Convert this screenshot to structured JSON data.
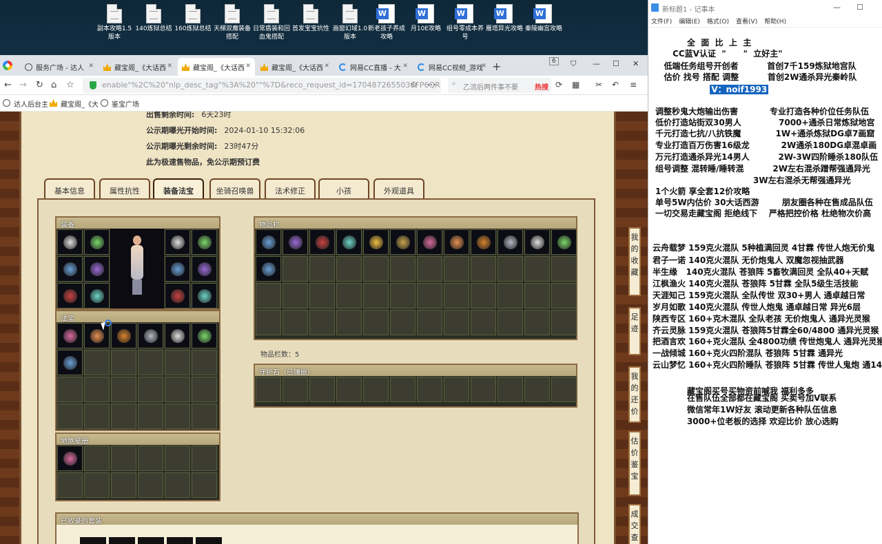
{
  "desktop": {
    "icons": [
      {
        "label": "副本攻略1.5版本",
        "type": "file"
      },
      {
        "label": "140炼狱总结",
        "type": "file"
      },
      {
        "label": "160炼狱总结",
        "type": "file"
      },
      {
        "label": "天梯双魔装备搭配",
        "type": "file"
      },
      {
        "label": "日常盾装和回血鬼搭配",
        "type": "file"
      },
      {
        "label": "首发宝宝抗性",
        "type": "file"
      },
      {
        "label": "画窗幻域1.0版本",
        "type": "file"
      },
      {
        "label": "新老孩子养成攻略",
        "type": "word"
      },
      {
        "label": "月10E攻略",
        "type": "word"
      },
      {
        "label": "组号零成本养号",
        "type": "word"
      },
      {
        "label": "雁塔异光攻略",
        "type": "word"
      },
      {
        "label": "秦陵幽宫攻略",
        "type": "word"
      }
    ]
  },
  "browser": {
    "tabs": [
      {
        "label": "服务广场 - 达人",
        "icon": "globe-icon",
        "active": false
      },
      {
        "label": "藏宝阁_《大话西",
        "icon": "crown-icon",
        "active": false
      },
      {
        "label": "藏宝阁_《大话西",
        "icon": "crown-icon",
        "active": true
      },
      {
        "label": "藏宝阁_《大话西",
        "icon": "crown-icon",
        "active": false
      },
      {
        "label": "网易CC直播 - 大",
        "icon": "cc-icon",
        "active": false
      },
      {
        "label": "网易CC视频_游戏",
        "icon": "cc-icon",
        "active": false
      }
    ],
    "tab_count": "6",
    "url": "enable\"%2C%20\"nlp_desc_tag\"%3A%20\"\"%7D&reco_request_id=1704872655036FP6QR",
    "search_placeholder": "乙流后两件事不要",
    "hot_label": "热搜",
    "bookmarks": [
      "达人后台主",
      "藏宝阁_《大",
      "鉴宝广场"
    ]
  },
  "page": {
    "info_rows": [
      {
        "label": "出售剩余时间:",
        "value": "6天23时"
      },
      {
        "label": "公示期曝光开始时间:",
        "value": "2024-01-10 15:32:06"
      },
      {
        "label": "公示期曝光剩余时间:",
        "value": "23时47分"
      },
      {
        "label": "此为极速售物品，免公示期预订费",
        "value": ""
      }
    ],
    "tabs": [
      "基本信息",
      "属性抗性",
      "装备法宝",
      "坐骑召唤兽",
      "法术修正",
      "小孩",
      "外观道具"
    ],
    "active_tab": "装备法宝",
    "equip_title": "装备",
    "fabao_title": "法宝",
    "disha_title": "地煞星册",
    "items_title": "物品栏",
    "items_count_label": "物品栏数：5",
    "guard_title": "守护石（已镶嵌）",
    "suits_title": "已收录的套装",
    "side_panels": [
      "我的收藏",
      "足迹",
      "我的还价",
      "估价鉴宝",
      "成交查"
    ]
  },
  "notepad": {
    "title": "新标题1 - 记事本",
    "menu": [
      "文件(F)",
      "编辑(E)",
      "格式(O)",
      "查看(V)",
      "帮助(H)"
    ],
    "lines": [
      "           全  面  比  上  主",
      "      CC蓝V认证  \"      \"  立好主\"",
      "   低端任务组号开创者          首创7千159炼狱地宫队",
      "   估价 找号 搭配 调整          首创2W通杀异光秦岭队",
      "                   V：noif1993",
      "",
      "调整秒鬼大炮输出伤害           专业打造各种价位任务队伍",
      "低价打造站街双30男人             7000+通杀日常炼狱地宫",
      "千元打造七抗/八抗铁魔            1W+通杀炼狱DG卓7画窟",
      "专业打造百万伤害16级龙           2W通杀180DG卓混卓画",
      "万元打造通杀异光14男人          2W-3W四阶睡杀180队伍",
      "组号调整 混转睡/睡转混          2W左右混杀蹭帮强通异光",
      "                                  3W左右混杀无帮强通异光",
      "1个火箭 享全套12价攻略",
      "单号5W内估价 30大话西游        朋友圈各种在售成品队伍",
      "一切交易走藏宝阁 拒绝线下    严格把控价格 杜绝物次价高",
      "",
      "云舟载梦 159克火混队 5种植满回灵 4甘霖 传世人炮无价鬼",
      "君子一诺 140克火混队 无价炮鬼人 双魔忽视抽武器",
      "半生缘   140克火混队 苍狼阵 5畜牧满回灵 全队40+天赋",
      "江枫渔火 140克火混队 苍狼阵 5甘霖 全队5级生活技能",
      "天涯知己 159克火混队 全队传世 双30+男人 通卓越日常",
      "岁月如歌 140克火混队 传世人炮鬼 通卓越日常 异光6层",
      "陕西专区 160+克木混队 全队老孩 无价炮鬼人 通异光灵猴",
      "齐云灵脉 159克火混队 苍狼阵5甘霖全60/4800 通异光灵猴",
      "把酒言欢 160+克火混队 全4800功绩 传世炮鬼人 通异光灵猴",
      "一战倾城 160+克火四阶混队 苍狼阵 5甘霖 通异光",
      "云山梦忆 160+克火四阶睡队 苍狼阵 5甘霖 传世人鬼炮 通14",
      "",
      "           藏宝阁买号买物资前喊我 福利多多",
      "           在售队伍全部都在藏宝阁 买卖号加V联系",
      "           微信常年1W好友 滚动更新各种队伍信息",
      "           3000+位老板的选择 欢迎比价 放心选购"
    ],
    "selected_line_index": 4
  },
  "colors": {
    "parchment": "#efe4c4",
    "frame": "#5a2e16",
    "selection": "#1565c0"
  }
}
